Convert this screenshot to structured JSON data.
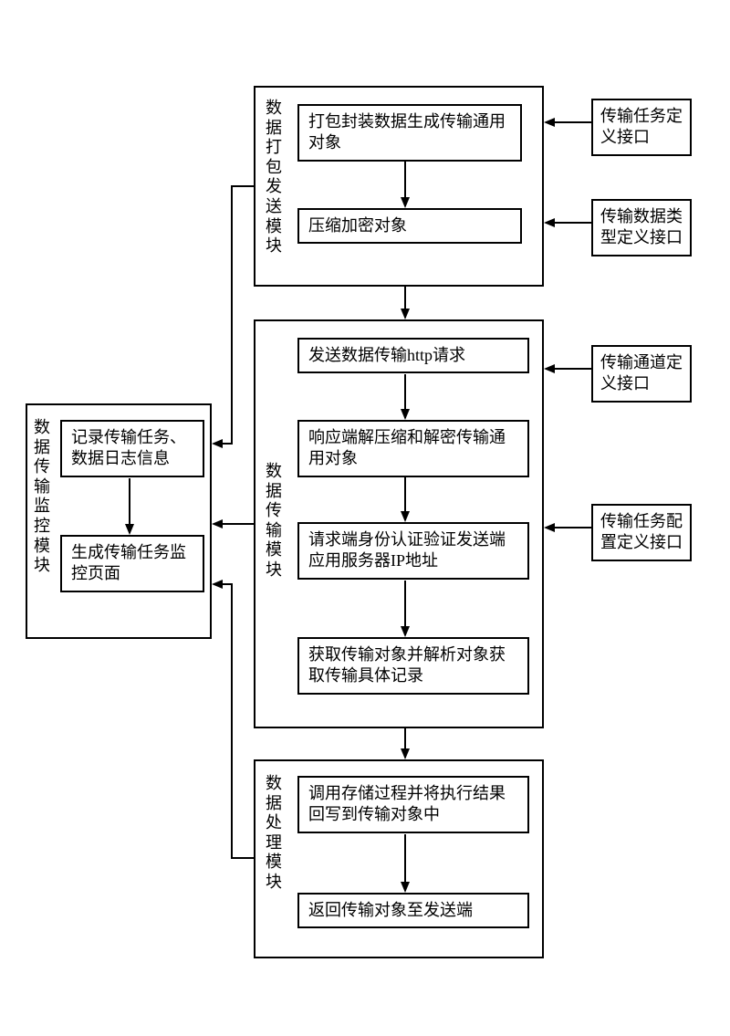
{
  "modules": {
    "package": {
      "label": "数据打包发送模块",
      "steps": {
        "pack": "打包封装数据生成传输通用对象",
        "compress": "压缩加密对象"
      }
    },
    "transfer": {
      "label": "数据传输模块",
      "steps": {
        "send_http": "发送数据传输http请求",
        "decompress": "响应端解压缩和解密传输通用对象",
        "auth": "请求端身份认证验证发送端应用服务器IP地址",
        "get_parse": "获取传输对象并解析对象获取传输具体记录"
      }
    },
    "process": {
      "label": "数据处理模块",
      "steps": {
        "stored_proc": "调用存储过程并将执行结果回写到传输对象中",
        "return": "返回传输对象至发送端"
      }
    },
    "monitor": {
      "label": "数据传输监控模块",
      "steps": {
        "log": "记录传输任务、数据日志信息",
        "page": "生成传输任务监控页面"
      }
    }
  },
  "interfaces": {
    "task_def": "传输任务定义接口",
    "datatype_def": "传输数据类型定义接口",
    "channel_def": "传输通道定义接口",
    "task_config_def": "传输任务配置定义接口"
  }
}
